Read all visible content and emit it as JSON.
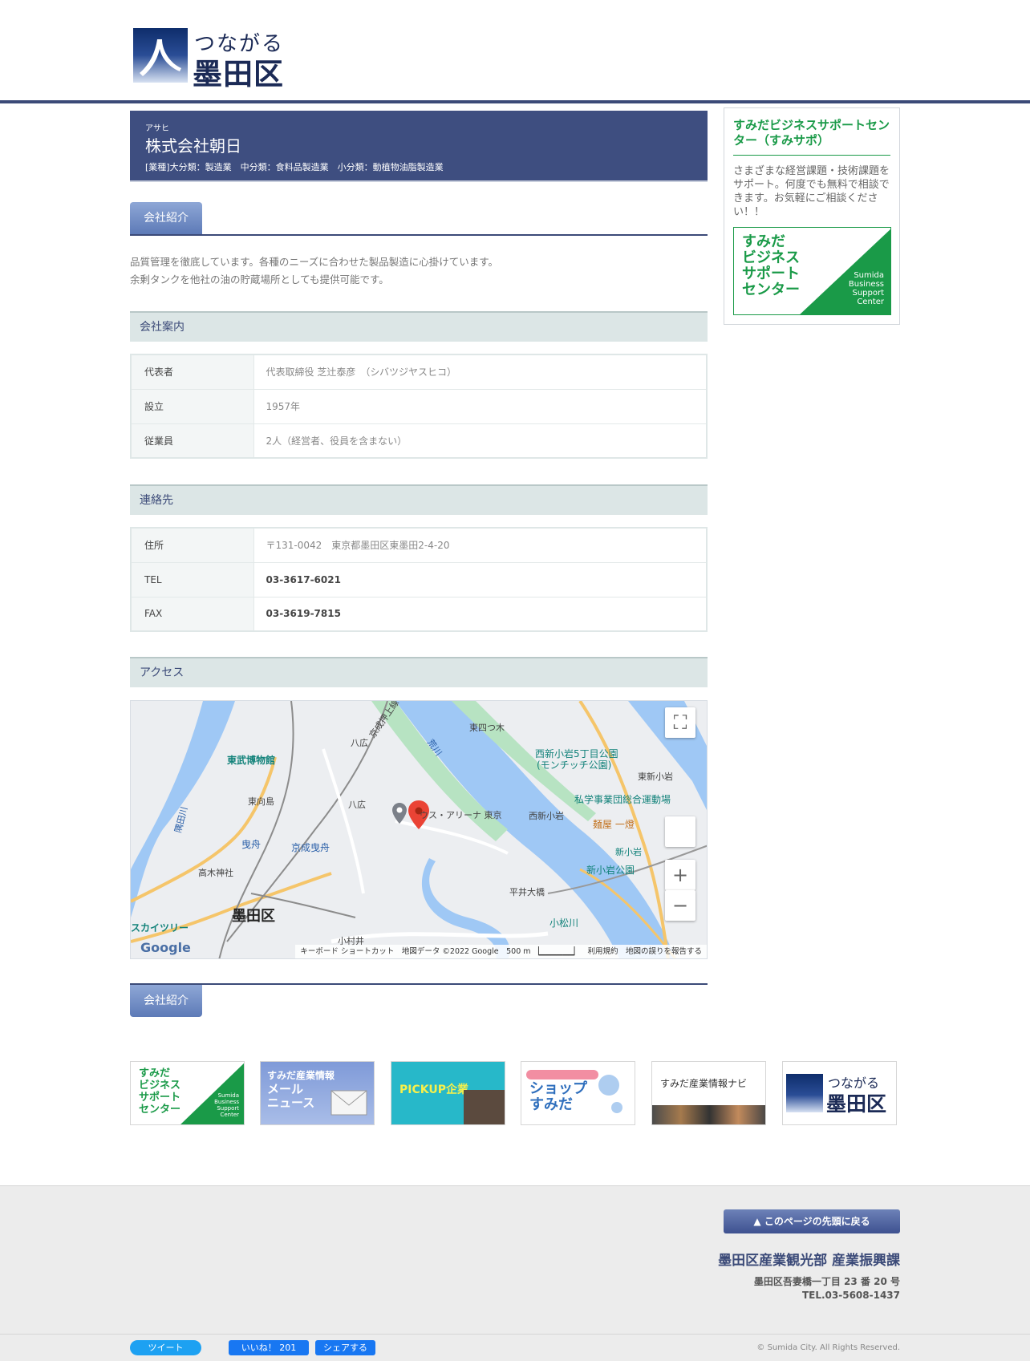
{
  "header": {
    "logo_small": "つながる",
    "logo_big": "墨田区"
  },
  "company": {
    "ruby": "アサヒ",
    "name": "株式会社朝日",
    "industry": "[業種]大分類：製造業　中分類：食料品製造業　小分類：動植物油脂製造業"
  },
  "sections": {
    "intro_tab": "会社紹介",
    "intro_text_1": "品質管理を徹底しています。各種のニーズに合わせた製品製造に心掛けています。",
    "intro_text_2": "余剰タンクを他社の油の貯蔵場所としても提供可能です。",
    "company_info_heading": "会社案内",
    "contact_heading": "連絡先",
    "access_heading": "アクセス",
    "bottom_tab": "会社紹介"
  },
  "company_info": [
    {
      "label": "代表者",
      "value": "代表取締役 芝辻泰彦　（シバツジヤスヒコ）"
    },
    {
      "label": "設立",
      "value": "1957年"
    },
    {
      "label": "従業員",
      "value": "2人（経営者、役員を含まない）"
    }
  ],
  "contact": [
    {
      "label": "住所",
      "value": "〒131-0042　東京都墨田区東墨田2-4-20"
    },
    {
      "label": "TEL",
      "value": "03-3617-6021"
    },
    {
      "label": "FAX",
      "value": "03-3619-7815"
    }
  ],
  "map": {
    "labels": {
      "tobu": "東武博物館",
      "higashimukojima": "東向島",
      "yahiro": "八広",
      "yahiro_st": "八広",
      "keisei": "京成曳舟",
      "hikifune": "曳舟",
      "takagi": "高木神社",
      "sumida": "墨田区",
      "skytree": "スカイツリー",
      "komurai": "小村井",
      "hirai": "平井大橋",
      "arena": "ウス・アリーナ 東京",
      "nishishinkoiwa": "西新小岩",
      "higashiyotsugi": "東四つ木",
      "park5": "西新小岩5丁目公園",
      "park5b": "(モンチッチ公園)",
      "higashishinkoiwa": "東新小岩",
      "sports": "私学事業団総合運動場",
      "menya": "麺屋 一燈",
      "shinkoiwa": "新小岩",
      "shinkoiwa_park": "新小岩公園",
      "komatsugawa": "小松川",
      "arakawa": "荒川",
      "sumidagawa": "隅田川",
      "keisei_line": "京成押上線"
    },
    "google": "Google",
    "attribution": "キーボード ショートカット　地図データ ©2022 Google　500 m ▕▁▁▁▁▁▁▏　利用規約　地図の誤りを報告する",
    "zoom_in": "+",
    "zoom_out": "−",
    "fullscreen": "⛶"
  },
  "sidebar": {
    "title": "すみだビジネスサポートセンター（すみサポ）",
    "desc": "さまざまな経営課題・技術課題をサポート。何度でも無料で相談できます。お気軽にご相談ください！！",
    "banner_jp": "すみだ\nビジネス\nサポート\nセンター",
    "banner_en": "Sumida\nBusiness\nSupport\nCenter"
  },
  "banners": {
    "b1_jp": "すみだ\nビジネス\nサポート\nセンター",
    "b1_en": "Sumida\nBusiness\nSupport\nCenter",
    "b2_title": "すみだ産業情報",
    "b2_sub": "メール\nニュース",
    "b3": "PICKUP企業",
    "b4": "ショップ\nすみだ",
    "b5": "すみだ産業情報ナビ",
    "b6_small": "つながる",
    "b6_big": "墨田区"
  },
  "footer": {
    "pagetop": "▲ このページの先頭に戻る",
    "dept": "墨田区産業観光部 産業振興課",
    "address": "墨田区吾妻橋一丁目 23 番 20 号",
    "tel": "TEL.03-5608-1437",
    "tweet": "ツイート",
    "like": "いいね！ 201",
    "share": "シェアする",
    "copyright": "© Sumida City. All Rights Reserved."
  },
  "colors": {
    "brand_navy": "#3b4a78",
    "title_bg": "#3e4e80",
    "support_green": "#1a9a48",
    "heading_bg": "#dce6e6"
  }
}
